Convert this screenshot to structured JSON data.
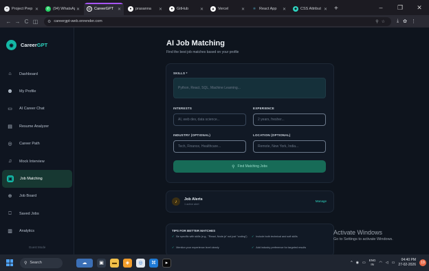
{
  "browser": {
    "tabs": [
      {
        "title": "Project Prep",
        "icon": "document-icon",
        "color": "#e8eaed"
      },
      {
        "title": "(94) WhatsApp",
        "icon": "whatsapp-icon",
        "color": "#25d366"
      },
      {
        "title": "CareerGPT",
        "icon": "globe-icon",
        "color": "#ffffff",
        "active": true
      },
      {
        "title": "prasanna",
        "icon": "github-icon",
        "color": "#ffffff"
      },
      {
        "title": "GitHub",
        "icon": "github-icon",
        "color": "#ffffff"
      },
      {
        "title": "Vercel",
        "icon": "vercel-icon",
        "color": "#ffffff"
      },
      {
        "title": "React App",
        "icon": "react-icon",
        "color": "#61dafb"
      },
      {
        "title": "CSS Attribut",
        "icon": "css-icon",
        "color": "#2dd4bf"
      }
    ],
    "url": "careergpt-web.onrender.com",
    "accent": "#a855f7"
  },
  "app": {
    "brand": {
      "name_part1": "Career",
      "name_part2": "GPT",
      "logo_icon": "compass-icon"
    },
    "nav": [
      {
        "label": "Dashboard",
        "icon": "dashboard-icon"
      },
      {
        "label": "My Profile",
        "icon": "profile-icon"
      },
      {
        "label": "AI Career Chat",
        "icon": "chat-icon"
      },
      {
        "label": "Resume Analyzer",
        "icon": "document-icon"
      },
      {
        "label": "Career Path",
        "icon": "compass-icon"
      },
      {
        "label": "Mock Interview",
        "icon": "microphone-icon"
      },
      {
        "label": "Job Matching",
        "icon": "briefcase-icon",
        "active": true
      },
      {
        "label": "Job Board",
        "icon": "globe-icon"
      },
      {
        "label": "Saved Jobs",
        "icon": "bookmark-icon"
      },
      {
        "label": "Analytics",
        "icon": "chart-icon"
      }
    ],
    "sidebar_footer": "Guest Mode",
    "page": {
      "title": "AI Job Matching",
      "subtitle": "Find the best job matches based on your profile"
    },
    "form": {
      "skills_label": "SKILLS *",
      "skills_placeholder": "Python, React, SQL, Machine Learning...",
      "interests_label": "INTERESTS",
      "interests_placeholder": "AI, web dev, data science...",
      "experience_label": "EXPERIENCE",
      "experience_placeholder": "2 years, fresher...",
      "industry_label": "INDUSTRY (OPTIONAL)",
      "industry_placeholder": "Tech, Finance, Healthcare...",
      "location_label": "LOCATION (OPTIONAL)",
      "location_placeholder": "Remote, New York, India...",
      "submit_label": "Find Matching Jobs"
    },
    "alerts": {
      "title": "Job Alerts",
      "subtitle": "1 active alert",
      "manage_label": "Manage"
    },
    "tips": {
      "title": "TIPS FOR BETTER MATCHES",
      "items": [
        "Be specific with skills (e.g., \"React, Node.js\" not just \"coding\")",
        "Include both technical and soft skills",
        "Mention your experience level clearly",
        "Add industry preference for targeted results"
      ]
    },
    "colors": {
      "accent": "#14b8a6",
      "active_nav_bg": "#173832",
      "button": "#176b57"
    }
  },
  "watermark": {
    "title": "Activate Windows",
    "subtitle": "Go to Settings to activate Windows."
  },
  "taskbar": {
    "search_label": "Search",
    "language_line1": "ENG",
    "language_line2": "IN",
    "time": "04:40 PM",
    "date": "27-02-2026",
    "notification_count": "19"
  }
}
